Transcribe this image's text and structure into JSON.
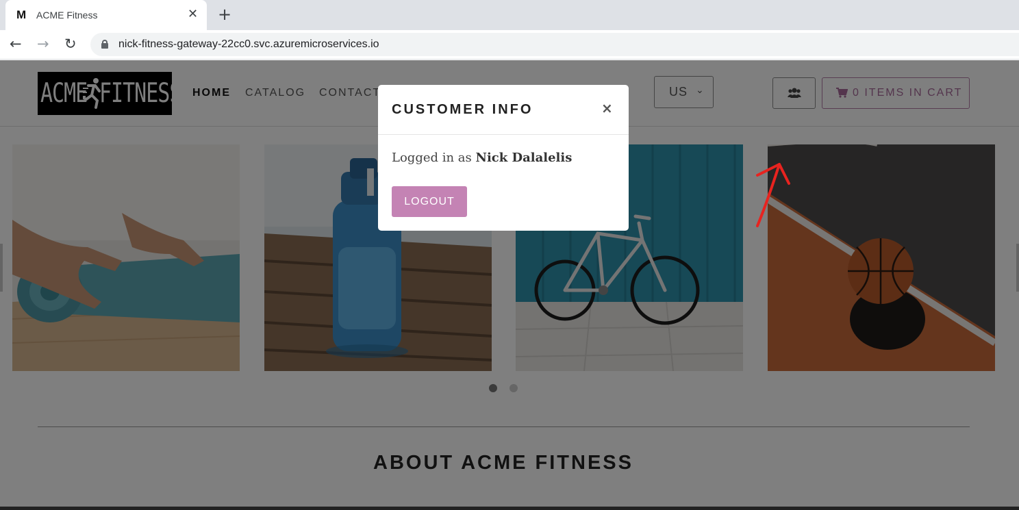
{
  "browser": {
    "tab_favicon": "M",
    "tab_title": "ACME Fitness",
    "tab_close": "✕",
    "new_tab": "+",
    "url": "nick-fitness-gateway-22cc0.svc.azuremicroservices.io"
  },
  "header": {
    "logo_left": "ACME",
    "logo_right": "FITNESS",
    "nav": [
      "HOME",
      "CATALOG",
      "CONTACT"
    ],
    "currency": "US",
    "cart_label": "0 ITEMS IN CART"
  },
  "carousel": {
    "slides": [
      "yoga-mat",
      "water-bottle",
      "bicycle",
      "basketball"
    ],
    "active_index": 0,
    "dot_count": 2
  },
  "about": {
    "title": "ABOUT ACME FITNESS"
  },
  "modal": {
    "title": "CUSTOMER INFO",
    "close": "×",
    "logged_in_prefix": "Logged in as ",
    "user_name": "Nick Dalalelis",
    "logout_label": "LOGOUT"
  },
  "colors": {
    "accent": "#c483b4",
    "cart_text": "#a86b9b",
    "annotation": "#e8231f"
  },
  "icons": [
    "back-arrow-icon",
    "forward-arrow-icon",
    "reload-icon",
    "lock-icon",
    "users-icon",
    "cart-icon",
    "close-icon",
    "annotation-arrow"
  ]
}
